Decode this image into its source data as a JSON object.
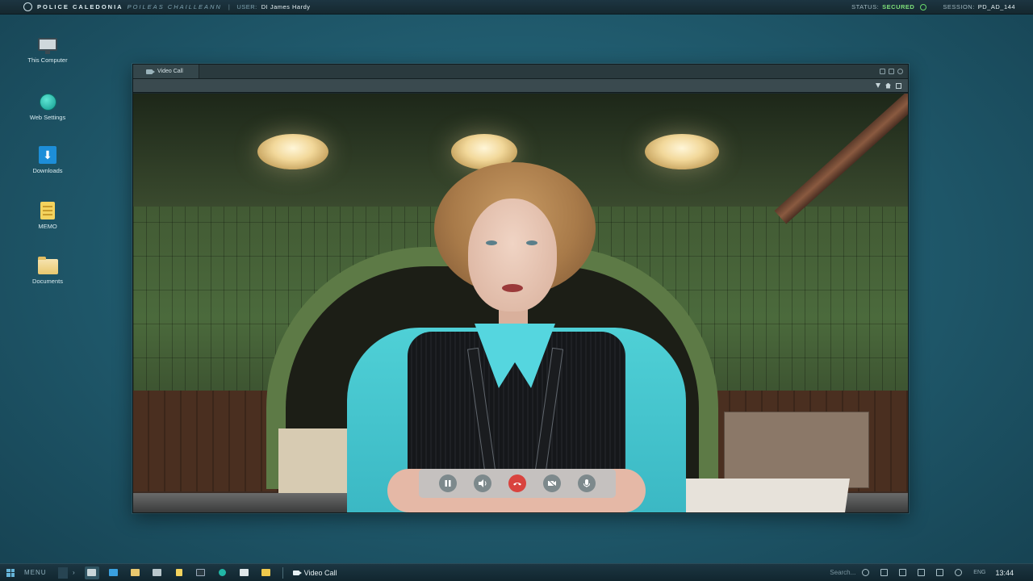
{
  "topbar": {
    "org_name": "POLICE CALEDONIA",
    "org_name_gaelic": "POILEAS CHAILLEANN",
    "user_label": "USER:",
    "user_name": "DI James Hardy",
    "status_label": "STATUS:",
    "status_value": "SECURED",
    "session_label": "SESSION:",
    "session_value": "PD_AD_144"
  },
  "desktop": {
    "icons": [
      {
        "label": "This Computer",
        "icon": "computer-icon"
      },
      {
        "label": "Web Settings",
        "icon": "globe-icon"
      },
      {
        "label": "Downloads",
        "icon": "download-icon"
      },
      {
        "label": "MEMO",
        "icon": "memo-icon"
      },
      {
        "label": "Documents",
        "icon": "folder-icon"
      }
    ]
  },
  "window": {
    "tab_title": "Video Call",
    "call_controls": [
      "pause-icon",
      "speaker-icon",
      "hangup-icon",
      "camera-off-icon",
      "microphone-icon"
    ]
  },
  "taskbar": {
    "menu_label": "MENU",
    "chevron": "›",
    "active_app_label": "Video Call",
    "search_placeholder": "Search...",
    "language": "ENG",
    "time": "13:44"
  },
  "colors": {
    "status_secured": "#7ee07a",
    "hangup": "#d9433e",
    "desktop_bg": "#215d70"
  }
}
